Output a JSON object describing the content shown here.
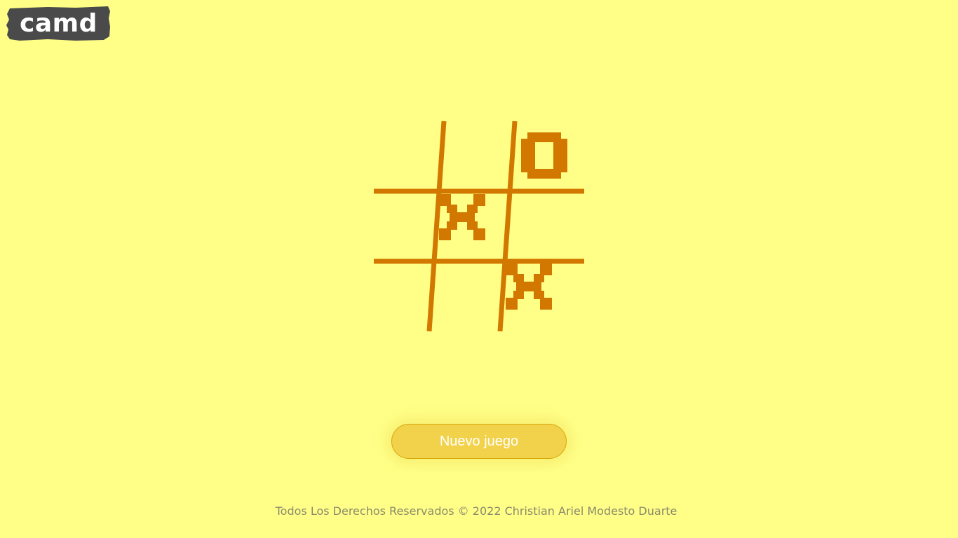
{
  "logo": {
    "text": "camd",
    "background_color": "#4a4a4a",
    "text_color": "#ffffff"
  },
  "board": {
    "line_color": "#d27800",
    "mark_color": "#d27800",
    "cells": [
      "",
      "",
      "O",
      "",
      "X",
      "",
      "",
      "",
      "X"
    ]
  },
  "new_game_button": {
    "label": "Nuevo juego",
    "background_color": "#f2d24a"
  },
  "footer": {
    "text": "Todos Los Derechos Reservados © 2022 Christian Ariel Modesto Duarte"
  },
  "page": {
    "background_color": "#ffff88"
  }
}
